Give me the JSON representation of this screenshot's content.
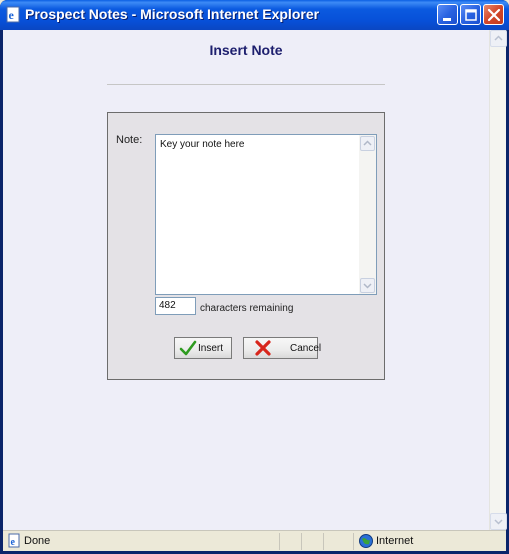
{
  "window": {
    "title": "Prospect Notes - Microsoft Internet Explorer",
    "icons": {
      "app": "ie-page-icon",
      "minimize": "minimize-icon",
      "maximize": "maximize-icon",
      "close": "close-icon"
    }
  },
  "page": {
    "heading": "Insert Note",
    "note": {
      "label": "Note:",
      "value": "Key your note here"
    },
    "counter": {
      "value": "482",
      "label": "characters remaining"
    },
    "buttons": {
      "insert": "Insert",
      "cancel": "Cancel"
    }
  },
  "statusbar": {
    "status": "Done",
    "zone": "Internet"
  },
  "colors": {
    "titlebar": "#0750d8",
    "heading": "#1d1f6e",
    "page_background": "#eeeef8",
    "panel": "#e4e2e6"
  }
}
